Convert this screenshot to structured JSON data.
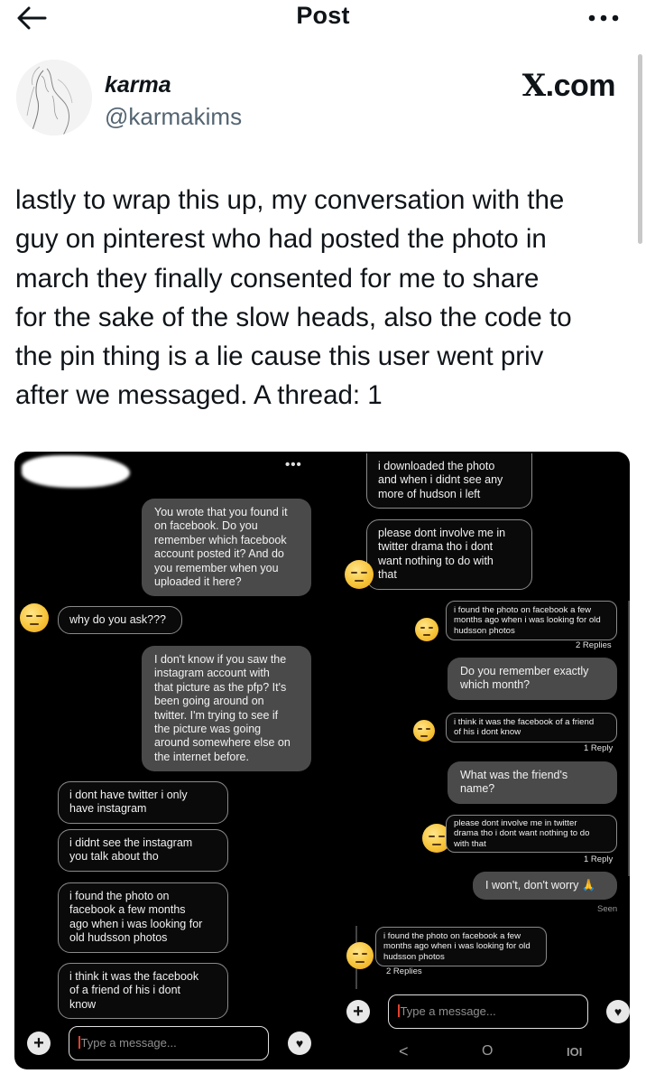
{
  "header": {
    "title": "Post"
  },
  "author": {
    "name": "karma",
    "handle": "@karmakims",
    "site_badge": ".com",
    "site_badge_x": "X"
  },
  "tweet": {
    "lines": [
      "lastly to wrap this up, my conversation with the",
      "guy on pinterest who had posted the photo in",
      "march they finally consented for me to share",
      "for the sake of the slow heads, also the code to",
      "the pin thing is a lie cause this user went priv",
      "after we messaged. A thread: 1"
    ]
  },
  "left_chat": {
    "more": "•••",
    "messages": [
      {
        "lines": [
          "You wrote that you found it",
          "on facebook. Do you",
          "remember which facebook",
          "account posted it? And do",
          "you remember when you",
          "uploaded it here?"
        ]
      },
      {
        "lines": [
          "why do you ask???"
        ]
      },
      {
        "lines": [
          "I don't know if you saw the",
          "instagram account with",
          "that picture as the pfp? It's",
          "been going around on",
          "twitter. I'm trying to see if",
          "the picture was going",
          "around somewhere else on",
          "the internet before."
        ]
      },
      {
        "lines": [
          "i dont have twitter i only",
          "have instagram"
        ]
      },
      {
        "lines": [
          "i didnt see the instagram",
          "you talk about tho"
        ]
      },
      {
        "lines": [
          "i found the photo on",
          "facebook a few months",
          "ago when i was looking for",
          "old hudsson photos"
        ]
      },
      {
        "lines": [
          "i think it was the facebook",
          "of a friend of his i dont",
          "know"
        ]
      }
    ],
    "input_placeholder": "Type a message...",
    "plus": "+",
    "heart": "♥"
  },
  "right_chat": {
    "messages": [
      {
        "lines": [
          "i downloaded the photo",
          "and when i didnt see any",
          "more of hudson i left"
        ]
      },
      {
        "lines": [
          "please dont involve me in",
          "twitter drama tho i dont",
          "want nothing to do with",
          "that"
        ]
      },
      {
        "lines": [
          "i found the photo on facebook a few",
          "months ago when i was looking for old",
          "hudsson photos"
        ]
      },
      {
        "lines": [
          "Do you remember exactly",
          "which month?"
        ]
      },
      {
        "lines": [
          "i think it was the facebook of a friend",
          "of his i dont know"
        ]
      },
      {
        "lines": [
          "What was the friend's",
          "name?"
        ]
      },
      {
        "lines": [
          "please dont involve me in twitter",
          "drama tho i dont want nothing to do",
          "with that"
        ]
      },
      {
        "lines": [
          "I won't, don't worry 🙏"
        ]
      },
      {
        "lines": [
          "i found the photo on facebook a few",
          "months ago when i was looking for old",
          "hudsson photos"
        ]
      }
    ],
    "replies_2": "2 Replies",
    "reply_1": "1 Reply",
    "reply_1b": "1 Reply",
    "replies_2b": "2 Replies",
    "seen": "Seen",
    "input_placeholder": "Type a message...",
    "plus": "+",
    "heart": "♥",
    "nav": {
      "back": "<",
      "home": "O",
      "recents": "IOI"
    }
  }
}
